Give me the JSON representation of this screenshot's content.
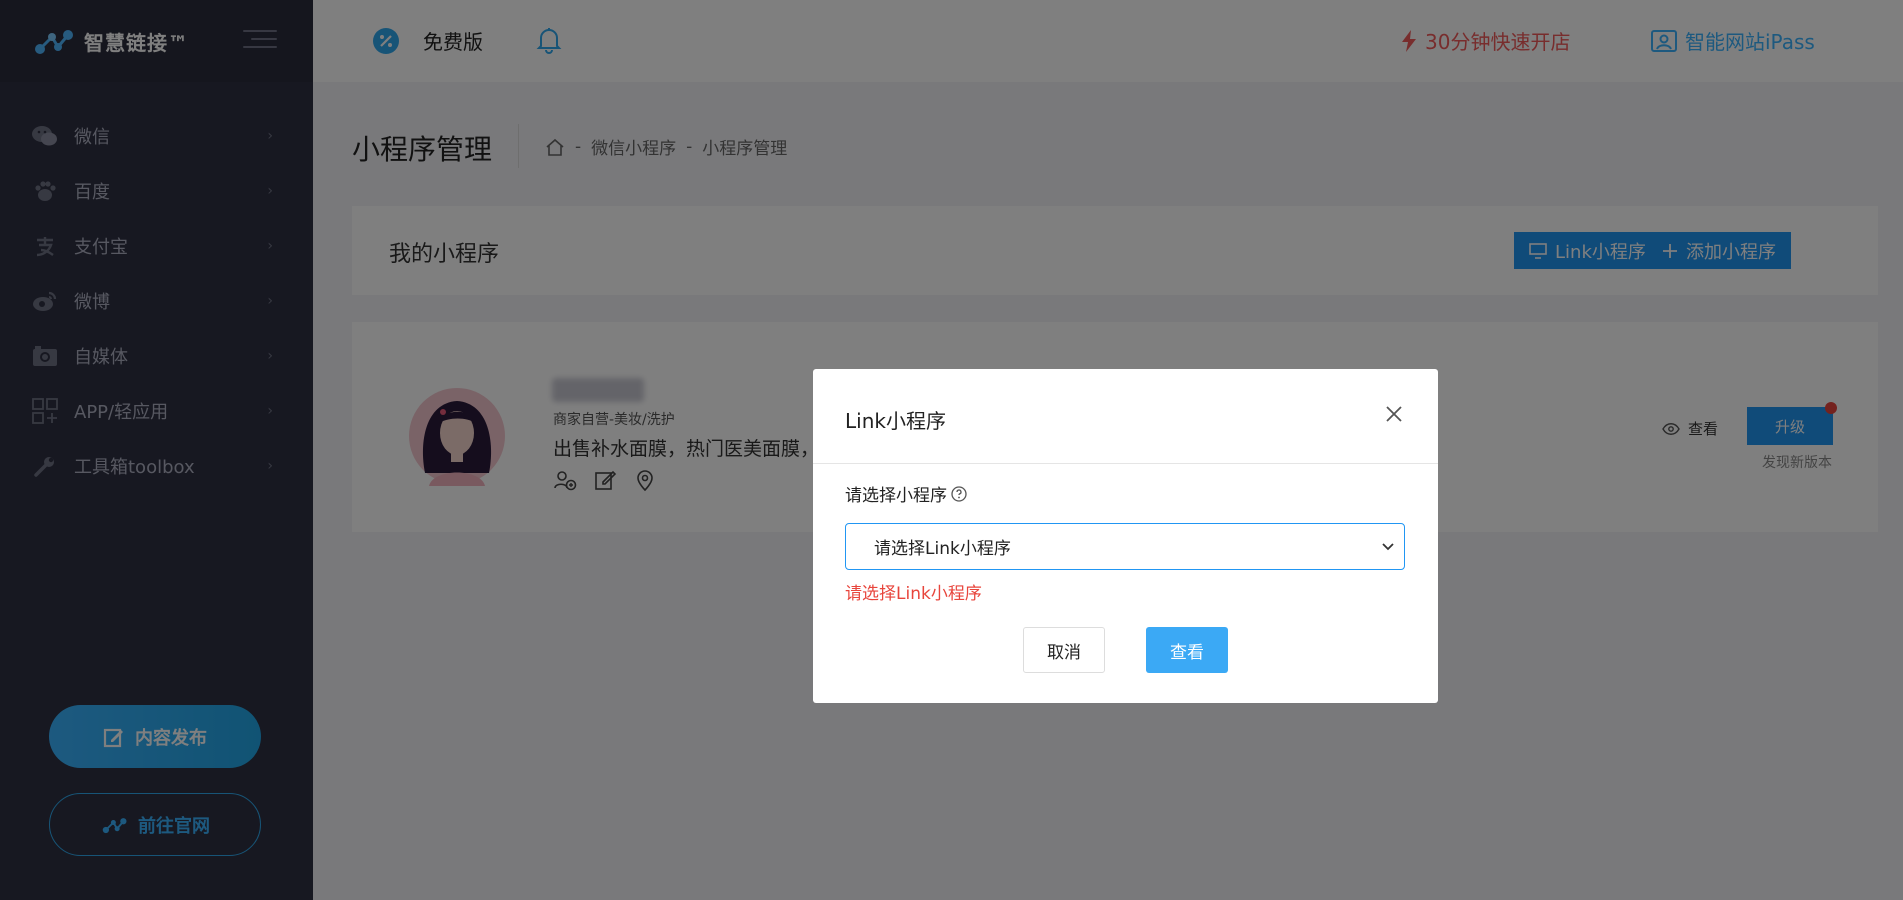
{
  "brand": {
    "name": "智慧链接™"
  },
  "header": {
    "version_label": "免费版",
    "quick_open": "30分钟快速开店",
    "ipass": "智能网站iPass"
  },
  "sidebar": {
    "items": [
      {
        "label": "微信",
        "icon": "wechat-icon"
      },
      {
        "label": "百度",
        "icon": "baidu-paw-icon"
      },
      {
        "label": "支付宝",
        "icon": "alipay-icon"
      },
      {
        "label": "微博",
        "icon": "weibo-icon"
      },
      {
        "label": "自媒体",
        "icon": "camera-icon"
      },
      {
        "label": "APP/轻应用",
        "icon": "apps-icon"
      },
      {
        "label": "工具箱toolbox",
        "icon": "wrench-icon"
      }
    ],
    "publish_label": "内容发布",
    "site_label": "前往官网"
  },
  "page": {
    "title": "小程序管理",
    "breadcrumb": [
      "微信小程序",
      "小程序管理"
    ]
  },
  "list_header": {
    "title": "我的小程序",
    "link_button": "Link小程序",
    "add_button": "添加小程序"
  },
  "item": {
    "category": "商家自营-美妆/洗护",
    "description": "出售补水面膜，热门医美面膜，爽",
    "view_label": "查看",
    "upgrade_label": "升级",
    "new_version": "发现新版本"
  },
  "modal": {
    "title": "Link小程序",
    "field_label": "请选择小程序",
    "select_value": "请选择Link小程序",
    "error": "请选择Link小程序",
    "cancel": "取消",
    "confirm": "查看"
  },
  "colors": {
    "sidebar_bg": "#2f3142",
    "accent": "#2196f3",
    "danger": "#f05a5a",
    "link": "#3ab3ff"
  }
}
